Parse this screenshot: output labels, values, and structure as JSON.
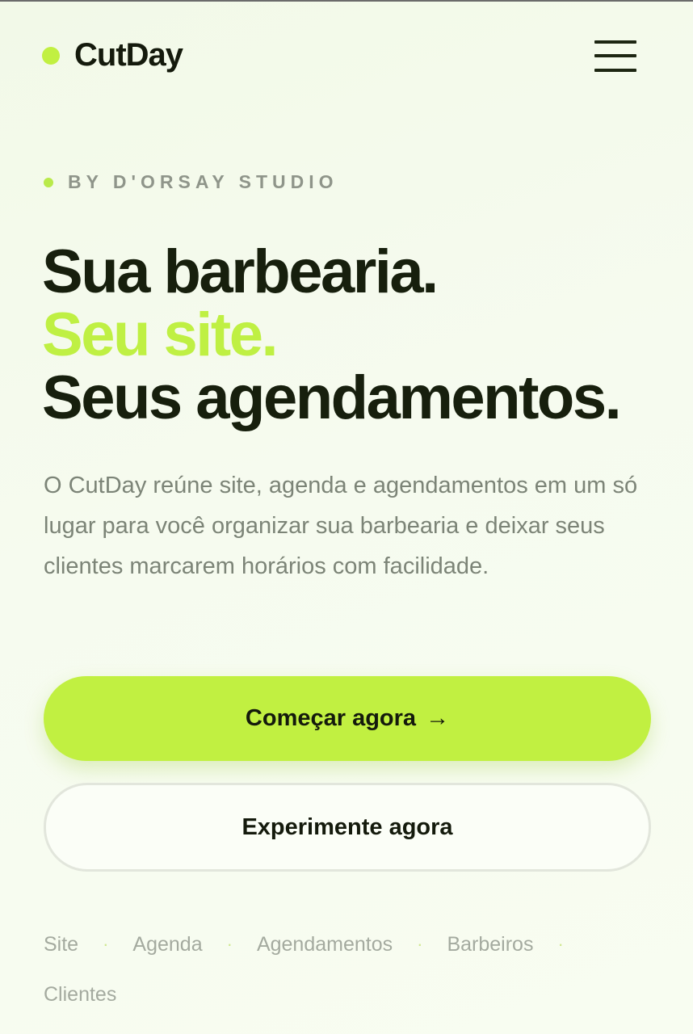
{
  "header": {
    "logo_text": "CutDay",
    "menu_icon": "hamburger-menu-icon"
  },
  "hero": {
    "eyebrow": "BY D'ORSAY STUDIO",
    "headline": {
      "line1": "Sua barbearia.",
      "line2": "Seu site.",
      "line3": "Seus agendamentos."
    },
    "description": "O CutDay reúne site, agenda e agendamentos em um só lugar para você organizar sua barbearia e deixar seus clientes marcarem horários com facilidade."
  },
  "buttons": {
    "primary_label": "Começar agora",
    "primary_arrow": "→",
    "secondary_label": "Experimente agora"
  },
  "features": {
    "items": [
      "Site",
      "Agenda",
      "Agendamentos",
      "Barbeiros",
      "Clientes"
    ],
    "separator": "·"
  },
  "colors": {
    "accent": "#c1f041",
    "text_dark": "#171f0d",
    "text_muted": "#7c8477",
    "background": "#f4faec"
  }
}
